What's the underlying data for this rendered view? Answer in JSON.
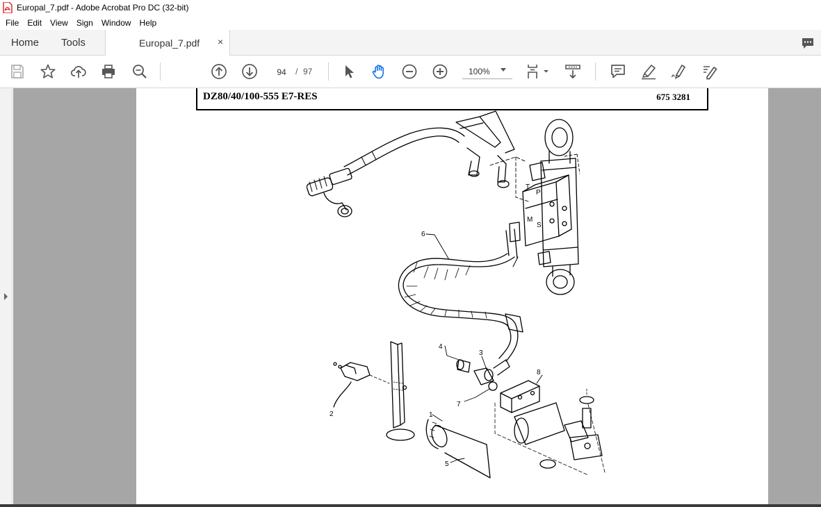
{
  "window": {
    "title": "Europal_7.pdf - Adobe Acrobat Pro DC (32-bit)"
  },
  "menu": [
    "File",
    "Edit",
    "View",
    "Sign",
    "Window",
    "Help"
  ],
  "tabs": {
    "home": "Home",
    "tools": "Tools",
    "document": "Europal_7.pdf",
    "close": "×"
  },
  "toolbar": {
    "current_page": "94",
    "separator": "/",
    "total_pages": "97",
    "zoom": "100%",
    "icons": [
      "save-icon",
      "star-icon",
      "cloud-upload-icon",
      "print-icon",
      "zoom-search-icon",
      "arrow-up-icon",
      "arrow-down-icon",
      "select-cursor-icon",
      "hand-tool-icon",
      "zoom-out-icon",
      "zoom-in-icon",
      "page-layout-icon",
      "scroll-mode-icon",
      "comment-icon",
      "highlight-icon",
      "sign-icon",
      "edit-pdf-icon"
    ]
  },
  "document": {
    "code": "DZ80/40/100-555 E7-RES",
    "part_number": "675 3281",
    "callouts": [
      "1",
      "2",
      "3",
      "4",
      "5",
      "6",
      "7",
      "8"
    ],
    "valve_labels": [
      "T",
      "P",
      "M",
      "S"
    ]
  },
  "colors": {
    "accent": "#1473e6",
    "canvas": "#a6a6a6",
    "toolbar_icon": "#555555"
  }
}
